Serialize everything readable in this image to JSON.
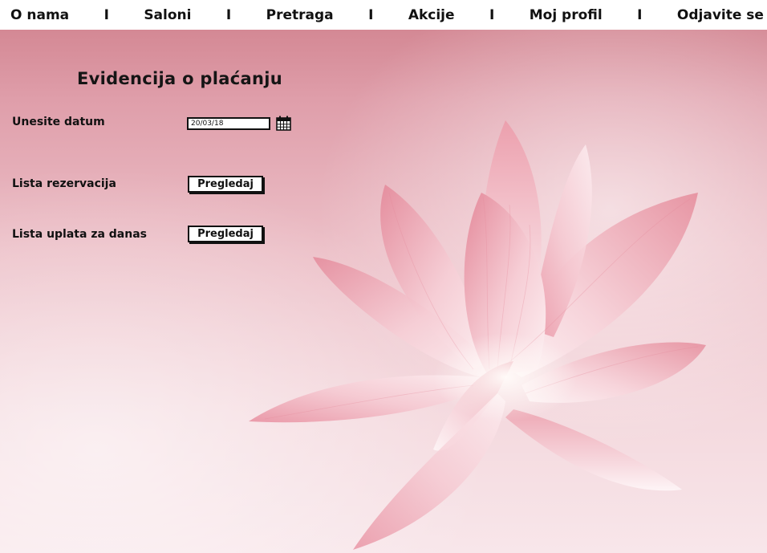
{
  "nav": {
    "items": [
      {
        "label": "O nama"
      },
      {
        "label": "Saloni"
      },
      {
        "label": "Pretraga"
      },
      {
        "label": "Akcije"
      },
      {
        "label": "Moj profil"
      },
      {
        "label": "Odjavite se"
      }
    ],
    "separator": "I"
  },
  "page": {
    "title": "Evidencija o plaćanju"
  },
  "date_field": {
    "label": "Unesite datum",
    "value": "20/03/18",
    "icon": "calendar-icon"
  },
  "reservations": {
    "label": "Lista rezervacija",
    "button_label": "Pregledaj"
  },
  "payments": {
    "label": "Lista uplata za danas",
    "button_label": "Pregledaj"
  },
  "background": {
    "image": "lotus-flower",
    "colors": {
      "top": "#cf7f8b",
      "bottom": "#f8e6ea",
      "petal": "#f3b9c4",
      "petal_dark": "#e4899a"
    }
  }
}
